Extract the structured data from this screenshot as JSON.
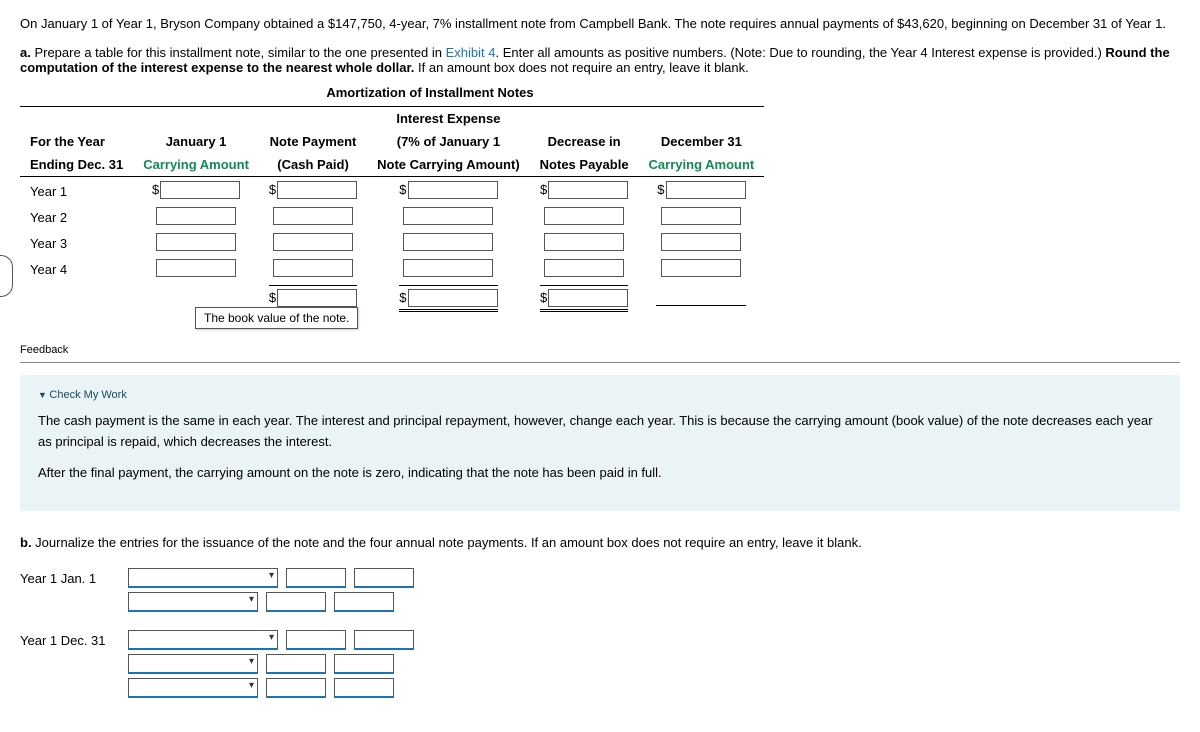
{
  "intro": "On January 1 of Year 1, Bryson Company obtained a $147,750, 4-year, 7% installment note from Campbell Bank. The note requires annual payments of $43,620, beginning on December 31 of Year 1.",
  "part_a": {
    "label": "a.",
    "text_before_link": " Prepare a table for this installment note, similar to the one presented in ",
    "link_text": "Exhibit 4",
    "text_after_link": ". Enter all amounts as positive numbers. (Note: Due to rounding, the Year 4 Interest expense is provided.) ",
    "bold_tail": "Round the computation of the interest expense to the nearest whole dollar.",
    "blank_note": " If an amount box does not require an entry, leave it blank."
  },
  "table_title": "Amortization of Installment Notes",
  "headers": {
    "col1_line1": "For the Year",
    "col1_line2": "Ending Dec. 31",
    "col2_line1": "January 1",
    "col2_line2": "Carrying Amount",
    "col3_line1": "Note Payment",
    "col3_line2": "(Cash Paid)",
    "col4_line0": "Interest Expense",
    "col4_line1": "(7% of January 1",
    "col4_line2": "Note Carrying Amount)",
    "col5_line1": "Decrease in",
    "col5_line2": "Notes Payable",
    "col6_line1": "December 31",
    "col6_line2": "Carrying Amount"
  },
  "rows": [
    "Year 1",
    "Year 2",
    "Year 3",
    "Year 4"
  ],
  "tooltip": "The book value of the note.",
  "feedback_label": "Feedback",
  "check_my_work": {
    "header": "Check My Work",
    "p1": "The cash payment is the same in each year. The interest and principal repayment, however, change each year. This is because the carrying amount (book value) of the note decreases each year as principal is repaid, which decreases the interest.",
    "p2": "After the final payment, the carrying amount on the note is zero, indicating that the note has been paid in full."
  },
  "part_b": {
    "label": "b.",
    "text": " Journalize the entries for the issuance of the note and the four annual note payments. If an amount box does not require an entry, leave it blank."
  },
  "journal": {
    "date1": "Year 1 Jan. 1",
    "date2": "Year 1 Dec. 31"
  },
  "chart_data": {
    "type": "table",
    "title": "Amortization of Installment Notes",
    "columns": [
      "For the Year Ending Dec. 31",
      "January 1 Carrying Amount",
      "Note Payment (Cash Paid)",
      "Interest Expense (7% of January 1 Note Carrying Amount)",
      "Decrease in Notes Payable",
      "December 31 Carrying Amount"
    ],
    "rows": [
      [
        "Year 1",
        null,
        null,
        null,
        null,
        null
      ],
      [
        "Year 2",
        null,
        null,
        null,
        null,
        null
      ],
      [
        "Year 3",
        null,
        null,
        null,
        null,
        null
      ],
      [
        "Year 4",
        null,
        null,
        null,
        null,
        null
      ]
    ],
    "totals_row": [
      null,
      null,
      null,
      null,
      null,
      null
    ],
    "given": {
      "principal": 147750,
      "term_years": 4,
      "rate": 0.07,
      "annual_payment": 43620
    }
  }
}
